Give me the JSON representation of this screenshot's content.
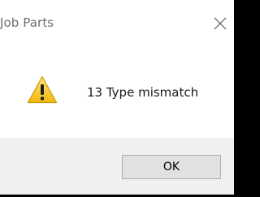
{
  "window": {
    "title": "Job Parts",
    "close_icon": "close-icon"
  },
  "dialog": {
    "icon": "warning-icon",
    "message": "13 Type mismatch"
  },
  "buttons": {
    "ok_label": "OK"
  },
  "colors": {
    "frame": "#000000",
    "dialog_background": "#ffffff",
    "footer_background": "#f0f0f0",
    "button_background": "#e1e1e1",
    "button_border": "#adadad",
    "warning_fill": "#f5c51a",
    "title_text": "#6e6e6e"
  }
}
